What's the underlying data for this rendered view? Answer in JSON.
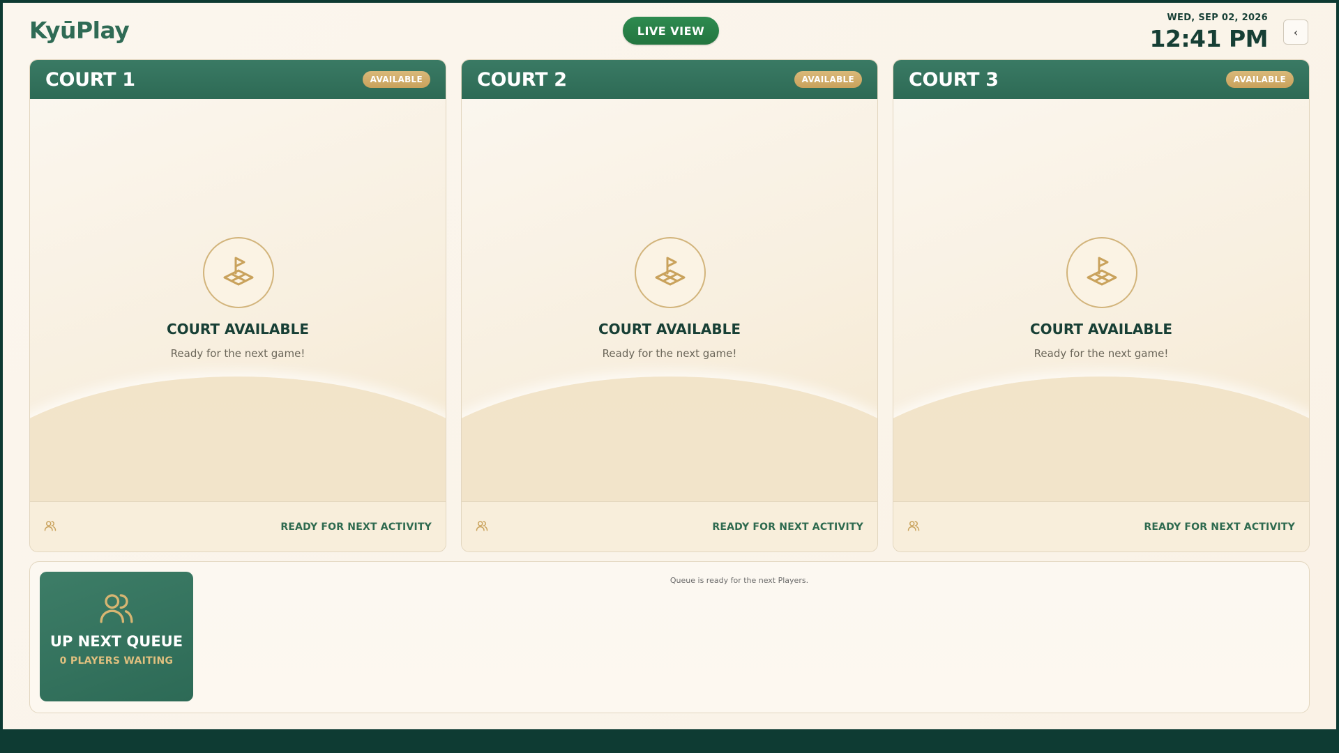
{
  "header": {
    "logo": "KyūPlay",
    "live_view_label": "LIVE VIEW",
    "date": "WED, SEP 02, 2026",
    "time": "12:41 PM",
    "back_icon": "chevron-left-icon"
  },
  "courts": [
    {
      "title": "COURT 1",
      "badge": "AVAILABLE",
      "status": "COURT AVAILABLE",
      "subtitle": "Ready for the next game!",
      "footer_text": "READY FOR NEXT ACTIVITY",
      "icon": "court-flag-icon",
      "footer_icon": "players-icon"
    },
    {
      "title": "COURT 2",
      "badge": "AVAILABLE",
      "status": "COURT AVAILABLE",
      "subtitle": "Ready for the next game!",
      "footer_text": "READY FOR NEXT ACTIVITY",
      "icon": "court-flag-icon",
      "footer_icon": "players-icon"
    },
    {
      "title": "COURT 3",
      "badge": "AVAILABLE",
      "status": "COURT AVAILABLE",
      "subtitle": "Ready for the next game!",
      "footer_text": "READY FOR NEXT ACTIVITY",
      "icon": "court-flag-icon",
      "footer_icon": "players-icon"
    }
  ],
  "queue": {
    "title": "UP NEXT QUEUE",
    "count_label": "0 PLAYERS WAITING",
    "message": "Queue is ready for the next Players.",
    "icon": "players-icon"
  },
  "colors": {
    "brand_green": "#2d6a55",
    "live_button": "#23753f",
    "gold_accent": "#c9a25c",
    "dark_text": "#173f35"
  }
}
